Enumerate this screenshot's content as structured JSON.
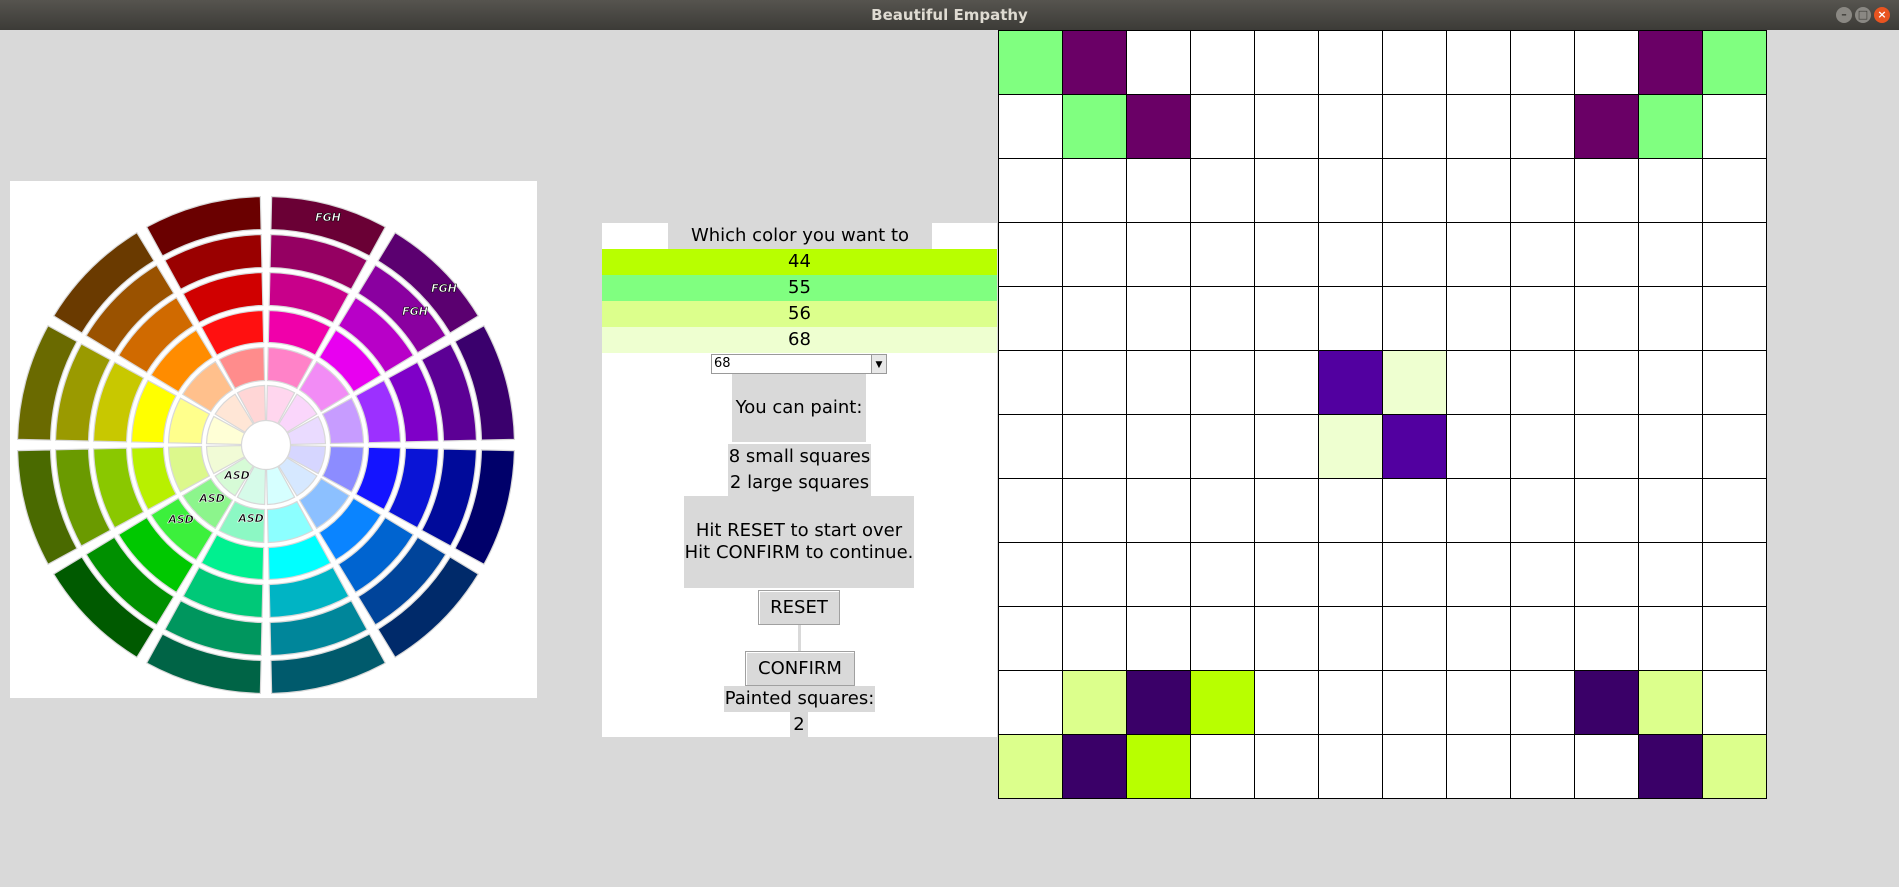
{
  "window": {
    "title": "Beautiful Empathy",
    "buttons": [
      {
        "icon": "minimize-icon",
        "glyph": "–",
        "color": "#8a8883"
      },
      {
        "icon": "maximize-icon",
        "glyph": "□",
        "color": "#8a8883"
      },
      {
        "icon": "close-icon",
        "glyph": "×",
        "color": "#e95420"
      }
    ]
  },
  "wheel": {
    "ring_colors": [
      [
        "#6a0035",
        "#950062",
        "#c8008a",
        "#f000aa",
        "#ff82c8",
        "#ffd6ee"
      ],
      [
        "#5b0070",
        "#8a00a0",
        "#b800c8",
        "#e800f0",
        "#f28cf5",
        "#fad6fb"
      ],
      [
        "#3a006d",
        "#5c0095",
        "#7f00c8",
        "#9c30ff",
        "#c79cff",
        "#eadbff"
      ],
      [
        "#00006a",
        "#000a9a",
        "#0a14d6",
        "#1414ff",
        "#8c8cff",
        "#d6d6ff"
      ],
      [
        "#002a6a",
        "#00449a",
        "#0064d0",
        "#0a84ff",
        "#8cc0ff",
        "#d6e8ff"
      ],
      [
        "#005a6c",
        "#00869a",
        "#00b4c4",
        "#00ffff",
        "#8cffff",
        "#d6ffff"
      ],
      [
        "#006446",
        "#00965e",
        "#00c878",
        "#00f090",
        "#8cf8c4",
        "#d6fbe9"
      ],
      [
        "#005a00",
        "#009000",
        "#00c800",
        "#3cf03c",
        "#8cf58c",
        "#d6fbd6"
      ],
      [
        "#4a6a00",
        "#6a9a00",
        "#8ac800",
        "#b8f000",
        "#dcf88c",
        "#f1fbd6"
      ],
      [
        "#6a6a00",
        "#9a9a00",
        "#c8c800",
        "#ffff00",
        "#ffff8c",
        "#ffffd6"
      ],
      [
        "#6a3a00",
        "#9a5200",
        "#d06a00",
        "#ff8c00",
        "#ffc08c",
        "#ffe6d6"
      ],
      [
        "#6a0000",
        "#9a0000",
        "#d00000",
        "#ff1010",
        "#ff8c8c",
        "#ffd6d6"
      ]
    ],
    "markers": [
      "FGH",
      "FGH",
      "FGH",
      "ASD",
      "ASD",
      "ASD",
      "ASD"
    ]
  },
  "panel": {
    "question": "Which color you want to use?",
    "options": [
      {
        "label": "44",
        "color": "#b8ff00"
      },
      {
        "label": "55",
        "color": "#80ff80"
      },
      {
        "label": "56",
        "color": "#dcff8c"
      },
      {
        "label": "68",
        "color": "#eeffd0"
      }
    ],
    "combo_value": "68",
    "can_paint_label": "You can paint:",
    "small_squares": "8 small squares",
    "large_squares": "2 large squares",
    "instructions_line1": "Hit RESET to start over",
    "instructions_line2": "Hit CONFIRM to continue.",
    "reset_label": "RESET",
    "confirm_label": "CONFIRM",
    "painted_label": "Painted squares:",
    "painted_count": "2"
  },
  "grid": {
    "cells": [
      [
        "#80ff80",
        "#6a0066",
        "#ffffff",
        "#ffffff",
        "#ffffff",
        "#ffffff",
        "#ffffff",
        "#ffffff",
        "#ffffff",
        "#ffffff",
        "#6a0066",
        "#80ff80"
      ],
      [
        "#ffffff",
        "#80ff80",
        "#6a0066",
        "#ffffff",
        "#ffffff",
        "#ffffff",
        "#ffffff",
        "#ffffff",
        "#ffffff",
        "#6a0066",
        "#80ff80",
        "#ffffff"
      ],
      [
        "#ffffff",
        "#ffffff",
        "#ffffff",
        "#ffffff",
        "#ffffff",
        "#ffffff",
        "#ffffff",
        "#ffffff",
        "#ffffff",
        "#ffffff",
        "#ffffff",
        "#ffffff"
      ],
      [
        "#ffffff",
        "#ffffff",
        "#ffffff",
        "#ffffff",
        "#ffffff",
        "#ffffff",
        "#ffffff",
        "#ffffff",
        "#ffffff",
        "#ffffff",
        "#ffffff",
        "#ffffff"
      ],
      [
        "#ffffff",
        "#ffffff",
        "#ffffff",
        "#ffffff",
        "#ffffff",
        "#ffffff",
        "#ffffff",
        "#ffffff",
        "#ffffff",
        "#ffffff",
        "#ffffff",
        "#ffffff"
      ],
      [
        "#ffffff",
        "#ffffff",
        "#ffffff",
        "#ffffff",
        "#ffffff",
        "#5200a0",
        "#eeffd0",
        "#ffffff",
        "#ffffff",
        "#ffffff",
        "#ffffff",
        "#ffffff"
      ],
      [
        "#ffffff",
        "#ffffff",
        "#ffffff",
        "#ffffff",
        "#ffffff",
        "#eeffd0",
        "#5200a0",
        "#ffffff",
        "#ffffff",
        "#ffffff",
        "#ffffff",
        "#ffffff"
      ],
      [
        "#ffffff",
        "#ffffff",
        "#ffffff",
        "#ffffff",
        "#ffffff",
        "#ffffff",
        "#ffffff",
        "#ffffff",
        "#ffffff",
        "#ffffff",
        "#ffffff",
        "#ffffff"
      ],
      [
        "#ffffff",
        "#ffffff",
        "#ffffff",
        "#ffffff",
        "#ffffff",
        "#ffffff",
        "#ffffff",
        "#ffffff",
        "#ffffff",
        "#ffffff",
        "#ffffff",
        "#ffffff"
      ],
      [
        "#ffffff",
        "#ffffff",
        "#ffffff",
        "#ffffff",
        "#ffffff",
        "#ffffff",
        "#ffffff",
        "#ffffff",
        "#ffffff",
        "#ffffff",
        "#ffffff",
        "#ffffff"
      ],
      [
        "#ffffff",
        "#dcff8c",
        "#3a0068",
        "#b8ff00",
        "#ffffff",
        "#ffffff",
        "#ffffff",
        "#ffffff",
        "#ffffff",
        "#3a0068",
        "#dcff8c",
        "#ffffff"
      ],
      [
        "#dcff8c",
        "#3a0068",
        "#b8ff00",
        "#ffffff",
        "#ffffff",
        "#ffffff",
        "#ffffff",
        "#ffffff",
        "#ffffff",
        "#ffffff",
        "#3a0068",
        "#dcff8c"
      ]
    ]
  }
}
